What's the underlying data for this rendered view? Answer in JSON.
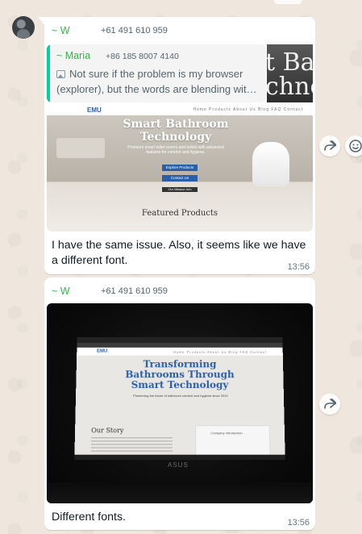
{
  "chat": {
    "messages": [
      {
        "sender_name": "~ W",
        "sender_phone": "+61 491 610 959",
        "quoted": {
          "name": "~ Maria",
          "phone": "+86 185 8007 4140",
          "text": "Not sure if the problem is my browser (explorer), but the words are blending wit…",
          "thumb_line1": "t Bat",
          "thumb_line2": "chno"
        },
        "image": {
          "logo": "EMU",
          "menu": "Home  Products  About Us  Blog  FAQ  Contact",
          "title": "Smart Bathroom Technology",
          "subtitle": "Premium smart toilet covers and toilets with advanced features for comfort and hygiene.",
          "button1": "Explore Products",
          "button2": "Contact Us",
          "button3": "Our Mission Info",
          "section": "Featured Products"
        },
        "caption": "I have the same issue. Also, it seems like we have a different font.",
        "time": "13:56"
      },
      {
        "sender_name": "~ W",
        "sender_phone": "+61 491 610 959",
        "image": {
          "logo": "EMU",
          "menu": "Home  Products  About Us  Blog  FAQ  Contact",
          "title": "Transforming Bathrooms Through Smart Technology",
          "subtitle": "Pioneering the future of bathroom comfort and hygiene since 2010",
          "story_heading": "Our Story",
          "box_text": "Company Introduction",
          "brand": "ASUS"
        },
        "caption": "Different fonts.",
        "time": "13:56"
      }
    ]
  },
  "icons": {
    "forward": "forward-icon",
    "emoji": "emoji-icon",
    "photo": "photo-icon"
  }
}
